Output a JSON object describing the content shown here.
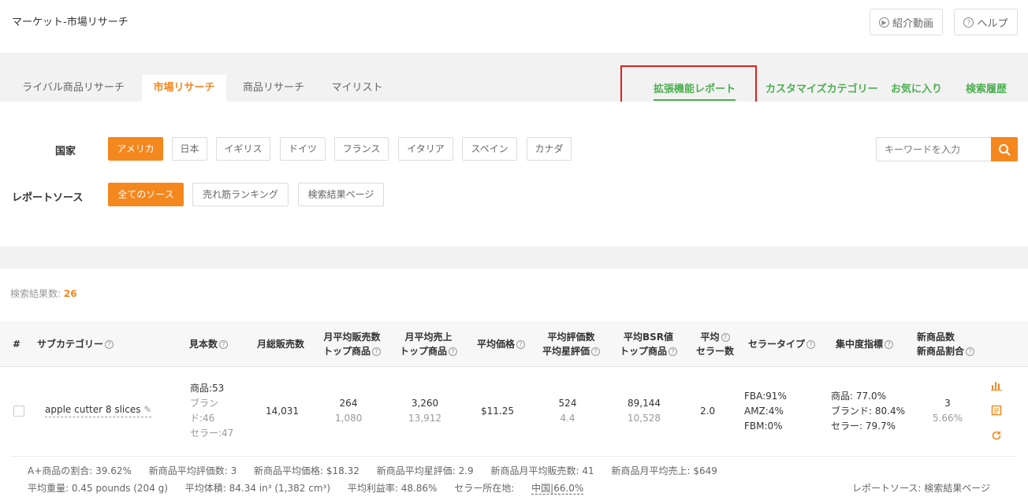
{
  "header": {
    "title": "マーケット-市場リサーチ",
    "intro_video": "紹介動画",
    "help": "ヘルプ"
  },
  "tabs": {
    "left": [
      "ライバル商品リサーチ",
      "市場リサーチ",
      "商品リサーチ",
      "マイリスト"
    ],
    "right": [
      "拡張機能レポート",
      "カスタマイズカテゴリー",
      "お気に入り",
      "検索履歴"
    ]
  },
  "filters": {
    "country_label": "国家",
    "countries": [
      "アメリカ",
      "日本",
      "イギリス",
      "ドイツ",
      "フランス",
      "イタリア",
      "スペイン",
      "カナダ"
    ],
    "source_label": "レポートソース",
    "sources": [
      "全てのソース",
      "売れ筋ランキング",
      "検索結果ページ"
    ],
    "search_placeholder": "キーワードを入力"
  },
  "results": {
    "count_label": "検索結果数:",
    "count": "26"
  },
  "table": {
    "headers": {
      "index": "#",
      "subcategory": "サブカテゴリー",
      "sample": "見本数",
      "monthly_sales": "月総販売数",
      "avg_sales_1": "月平均販売数",
      "avg_sales_2": "トップ商品",
      "avg_revenue_1": "月平均売上",
      "avg_revenue_2": "トップ商品",
      "avg_price": "平均価格",
      "avg_rating_1": "平均評価数",
      "avg_rating_2": "平均星評価",
      "avg_bsr_1": "平均BSR値",
      "avg_bsr_2": "トップ商品",
      "avg_seller_1": "平均",
      "avg_seller_2": "セラー数",
      "seller_type": "セラータイプ",
      "concentration": "集中度指標",
      "new_1": "新商品数",
      "new_2": "新商品割合"
    },
    "row": {
      "subcategory": "apple cutter 8 slices",
      "sample_products": "商品:53",
      "sample_brands_1": "ブラン",
      "sample_brands_2": "ド:46",
      "sample_sellers": "セラー:47",
      "monthly_sales": "14,031",
      "avg_sales": "264",
      "avg_sales_top": "1,080",
      "avg_revenue": "3,260",
      "avg_revenue_top": "13,912",
      "avg_price": "$11.25",
      "avg_rating_count": "524",
      "avg_rating_star": "4.4",
      "avg_bsr": "89,144",
      "avg_bsr_top": "10,528",
      "avg_sellers": "2.0",
      "fba": "FBA:91%",
      "amz": "AMZ:4%",
      "fbm": "FBM:0%",
      "conc_product": "商品: 77.0%",
      "conc_brand": "ブランド: 80.4%",
      "conc_seller": "セラー: 79.7%",
      "new_count": "3",
      "new_ratio": "5.66%"
    }
  },
  "footer": {
    "line1": [
      "A+商品の割合: 39.62%",
      "新商品平均評価数: 3",
      "新商品平均価格: $18.32",
      "新商品平均星評価: 2.9",
      "新商品月平均販売数: 41",
      "新商品月平均売上: $649"
    ],
    "line2_weight": "平均重量: 0.45 pounds (204 g)",
    "line2_volume": "平均体積: 84.34 in³ (1,382 cm³)",
    "line2_margin": "平均利益率: 48.86%",
    "line2_seller_loc_label": "セラー所在地:",
    "line2_seller_loc_value": "中国|66.0%",
    "source_text": "レポートソース: 検索結果ページ"
  },
  "colors": {
    "accent": "#f5871f",
    "green": "#4caf50",
    "highlight": "#e01e1e"
  }
}
